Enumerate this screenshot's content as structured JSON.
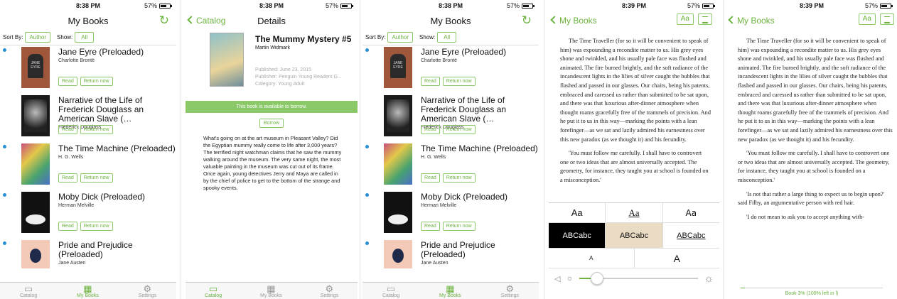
{
  "colors": {
    "accent": "#6cb33f",
    "unread_dot": "#2a8fd6"
  },
  "status": {
    "time_1": "8:38 PM",
    "time_2": "8:38 PM",
    "time_3": "8:38 PM",
    "time_4": "8:39 PM",
    "time_5": "8:39 PM",
    "battery": "57%"
  },
  "mybooks": {
    "title": "My Books",
    "sort_label": "Sort By:",
    "sort_value": "Author",
    "show_label": "Show:",
    "show_value": "All",
    "read_label": "Read",
    "return_label": "Return now",
    "books": [
      {
        "title": "Jane Eyre (Preloaded)",
        "author": "Charlotte Brontë",
        "unread": true
      },
      {
        "title": "Narrative of the Life of Frederick Douglass an American Slave (…",
        "author": "Frederick Douglass",
        "unread": false
      },
      {
        "title": "The Time Machine (Preloaded)",
        "author": "H. G. Wells",
        "unread": true
      },
      {
        "title": "Moby Dick (Preloaded)",
        "author": "Herman Melville",
        "unread": true
      },
      {
        "title": "Pride and Prejudice (Preloaded)",
        "author": "Jane Austen",
        "unread": true
      }
    ]
  },
  "tabs": {
    "catalog": "Catalog",
    "mybooks": "My Books",
    "settings": "Settings"
  },
  "details": {
    "back": "Catalog",
    "title": "Details",
    "book_title": "The Mummy Mystery #5",
    "author": "Martin Widmark",
    "published": "Published: June 23, 2015",
    "publisher": "Publisher: Penguin Young Readers G...",
    "category": "Category: Young Adult",
    "availability": "This book is available to borrow.",
    "borrow": "Borrow",
    "description": "What's going on at the art museum in Pleasant Valley? Did the Egyptian mummy really come to life after 3,000 years? The terrified night watchman claims that he saw the mummy walking around the museum. The very same night, the most valuable painting in the museum was cut out of its frame. Once again, young detectives Jerry and Maya are called in by the chief of police to get to the bottom of the strange and spooky events."
  },
  "reader": {
    "back": "My Books",
    "aa": "Aa",
    "p1": "The Time Traveller (for so it will be convenient to speak of him) was expounding a recondite matter to us. His grey eyes shone and twinkled, and his usually pale face was flushed and animated. The fire burned brightly, and the soft radiance of the incandescent lights in the lilies of silver caught the bubbles that flashed and passed in our glasses. Our chairs, being his patents, embraced and caressed us rather than submitted to be sat upon, and there was that luxurious after-dinner atmosphere when thought roams gracefully free of the trammels of precision. And he put it to us in this way—marking the points with a lean forefinger—as we sat and lazily admired his earnestness over this new paradox (as we thought it) and his fecundity.",
    "p2": "'You must follow me carefully. I shall have to controvert one or two ideas that are almost universally accepted. The geometry, for instance, they taught you at school is founded on a misconception.'",
    "p3": "'Is not that rather a large thing to expect us to begin upon?' said Filby, an argumentative person with red hair.",
    "p4": "'I do not mean to ask you to accept anything with-",
    "font_options": [
      "Aa",
      "Aa",
      "Aa"
    ],
    "theme_options": [
      "ABCabc",
      "ABCabc",
      "ABCabc"
    ],
    "size_small": "A",
    "size_large": "A",
    "brightness": 0.15,
    "progress_label": "Book 3% (100% left in l)",
    "progress": 0.03
  }
}
